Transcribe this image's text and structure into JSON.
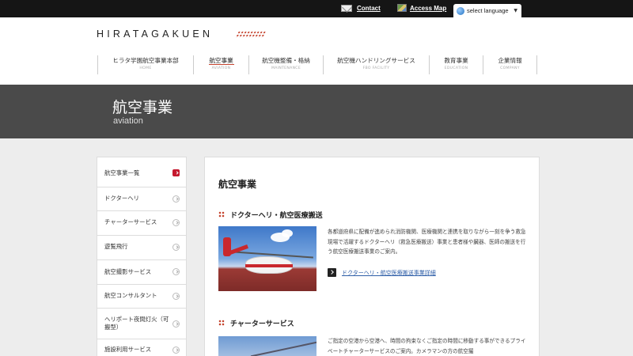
{
  "topbar": {
    "contact_label": "Contact",
    "access_label": "Access Map",
    "language_label": "select language",
    "icons": {
      "contact": "mail-icon",
      "access": "map-icon",
      "language": "globe-icon"
    }
  },
  "header": {
    "logo_text": "HIRATAGAKUEN",
    "nav": [
      {
        "label": "ヒラタ学園航空事業本部",
        "sub": "HOME"
      },
      {
        "label": "航空事業",
        "sub": "AVIATION"
      },
      {
        "label": "航空機整備・格納",
        "sub": "MAINTENANCE"
      },
      {
        "label": "航空機ハンドリングサービス",
        "sub": "FBO FACILITY"
      },
      {
        "label": "教育事業",
        "sub": "EDUCATION"
      },
      {
        "label": "企業情報",
        "sub": "COMPANY"
      }
    ],
    "active_nav": 1
  },
  "banner": {
    "title": "航空事業",
    "subtitle": "aviation"
  },
  "sidebar": {
    "items": [
      {
        "label": "航空事業一覧"
      },
      {
        "label": "ドクターヘリ"
      },
      {
        "label": "チャーターサービス"
      },
      {
        "label": "遊覧飛行"
      },
      {
        "label": "航空撮影サービス"
      },
      {
        "label": "航空コンサルタント"
      },
      {
        "label": "ヘリポート夜間灯火（可搬型）"
      },
      {
        "label": "施設利用サービス"
      }
    ],
    "active_item": 0
  },
  "content": {
    "title": "航空事業",
    "sections": [
      {
        "heading": "ドクターヘリ・航空医療搬送",
        "description": "各都道府県に配備が進められ消防機関、医療機関と連携を取りながら一刻を争う救急現場で活躍するドクターヘリ（救急医療搬送）事業と患者様や臓器、医師の搬送を行う航空医療搬送事業のご案内。",
        "link_label": "ドクターヘリ・航空医療搬送事業詳細"
      },
      {
        "heading": "チャーターサービス",
        "description": "ご指定の空港から空港へ、時間の拘束なくご指定の時間に移動する事ができるプライベートチャーターサービスのご案内。カメラマンの方の航空撮"
      }
    ]
  },
  "colors": {
    "accent": "#c5432e",
    "banner_bg": "#4a4a4a",
    "topbar_bg": "#151515",
    "link": "#2f5fa8"
  }
}
